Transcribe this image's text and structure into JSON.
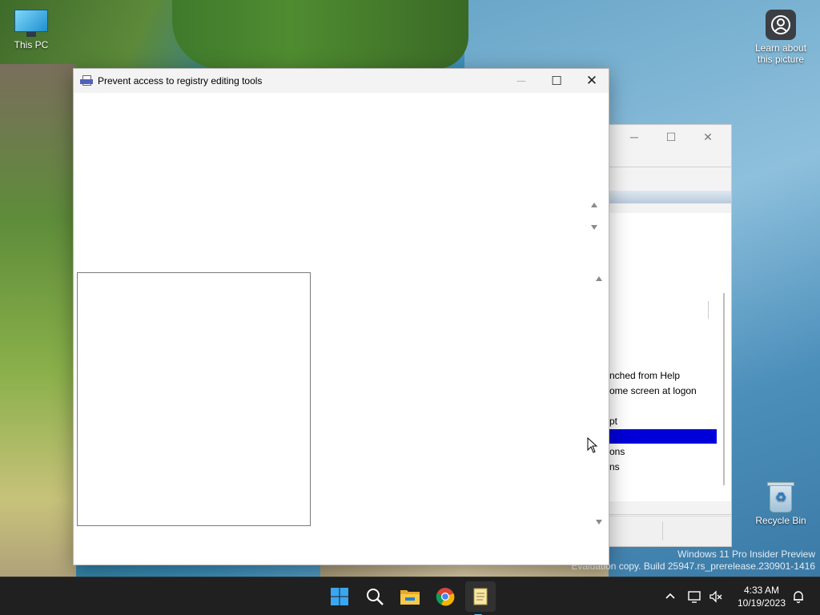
{
  "desktop": {
    "icons": [
      {
        "label": "This PC"
      },
      {
        "label": "Learn about this picture"
      },
      {
        "label": "Recycle Bin"
      }
    ],
    "watermark": {
      "line1": "Windows 11 Pro Insider Preview",
      "line2": "Evaluation copy. Build 25947.rs_prerelease.230901-1416"
    }
  },
  "dialog": {
    "title": "Prevent access to registry editing tools",
    "controls": {
      "minimize": "─",
      "maximize": "☐",
      "close": "✕"
    }
  },
  "background_window": {
    "controls": {
      "minimize": "─",
      "maximize": "☐",
      "close": "✕"
    },
    "list_items": [
      "nched from Help",
      "ome screen at logon",
      "pt",
      "",
      "ons",
      "ns"
    ]
  },
  "taskbar": {
    "apps": [
      {
        "name": "Start"
      },
      {
        "name": "Search"
      },
      {
        "name": "File Explorer"
      },
      {
        "name": "Google Chrome"
      },
      {
        "name": "Notepad"
      }
    ],
    "clock": {
      "time": "4:33 AM",
      "date": "10/19/2023"
    }
  },
  "colors": {
    "selection": "#0000d8",
    "taskbar": "#202020",
    "accent": "#6cc4f5"
  }
}
